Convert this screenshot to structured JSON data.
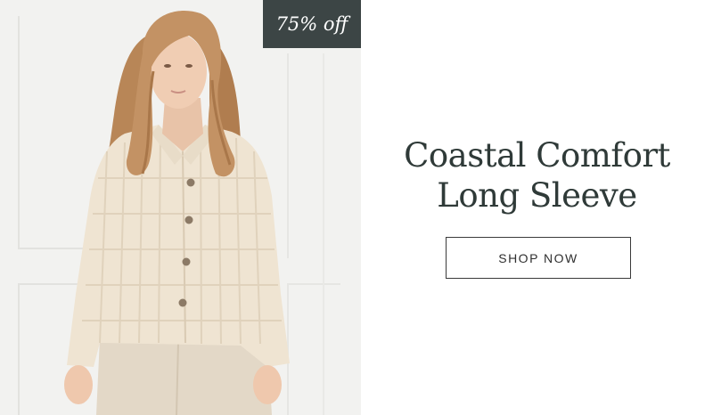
{
  "promo": {
    "discount_badge": "75% off",
    "title_line1": "Coastal Comfort",
    "title_line2": "Long Sleeve",
    "cta_label": "SHOP NOW"
  },
  "colors": {
    "badge_background": "#3c4545",
    "title_text": "#2f3a38",
    "button_border": "#3a3a3a"
  }
}
